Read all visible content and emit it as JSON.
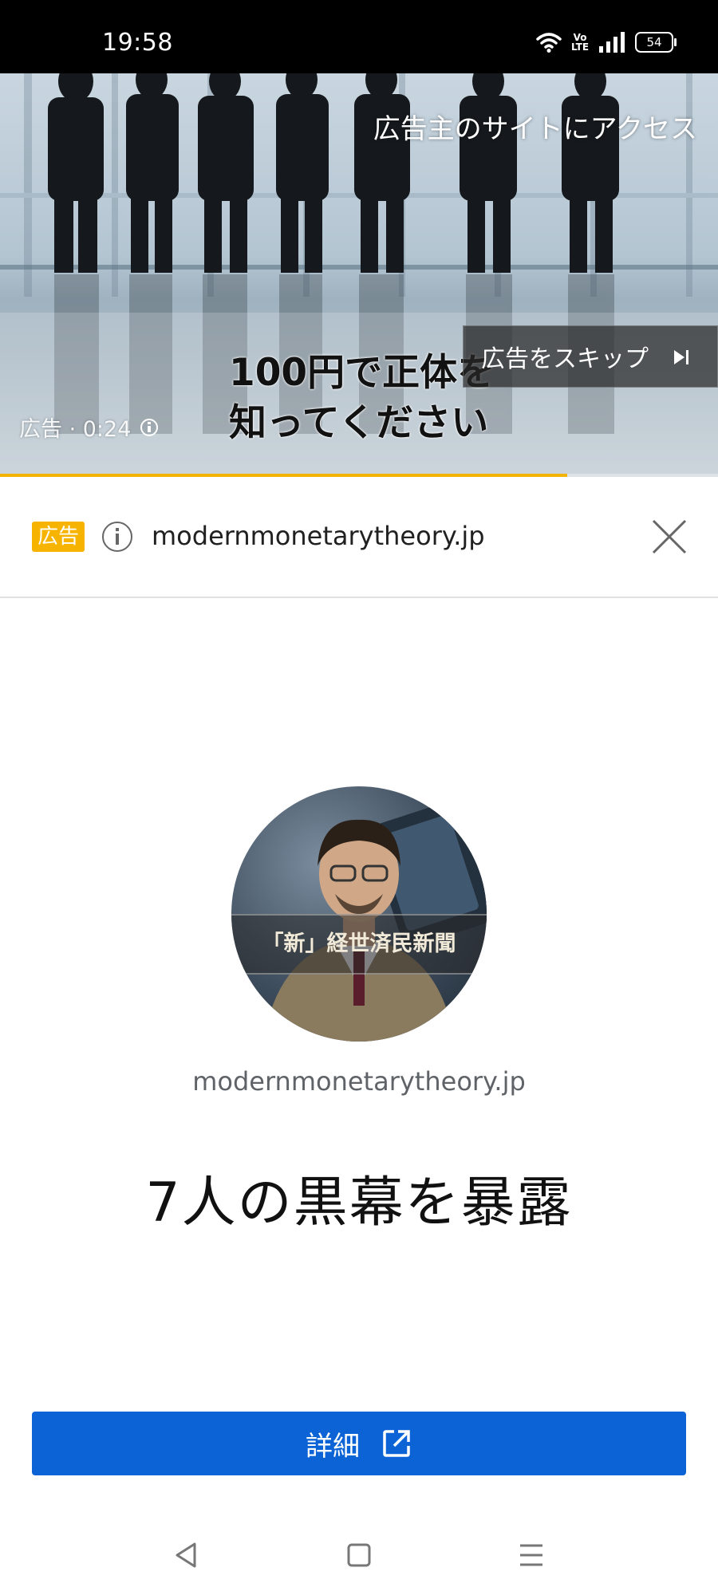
{
  "status_bar": {
    "time": "19:58",
    "volte": "Vo LTE",
    "battery": "54",
    "icons": [
      "wifi-icon",
      "volte-icon",
      "signal-icon",
      "battery-icon"
    ]
  },
  "video_ad": {
    "advertiser_link": "広告主のサイトにアクセス",
    "headline_line1": "100円で正体を",
    "headline_line2": "知ってください",
    "skip_label": "広告をスキップ",
    "timer": "広告 · 0:24",
    "progress": 0.79,
    "progress_color": "#f2b400"
  },
  "ad_bar": {
    "badge": "広告",
    "domain": "modernmonetarytheory.jp",
    "badge_color": "#f6b400"
  },
  "card": {
    "avatar_caption": "「新」経世済民新聞",
    "domain": "modernmonetarytheory.jp",
    "headline": "7人の黒幕を暴露"
  },
  "cta": {
    "label": "詳細",
    "color": "#0b63d6",
    "icon": "open-in-new-icon"
  },
  "nav": {
    "icons": [
      "back-icon",
      "home-icon",
      "menu-icon"
    ]
  }
}
